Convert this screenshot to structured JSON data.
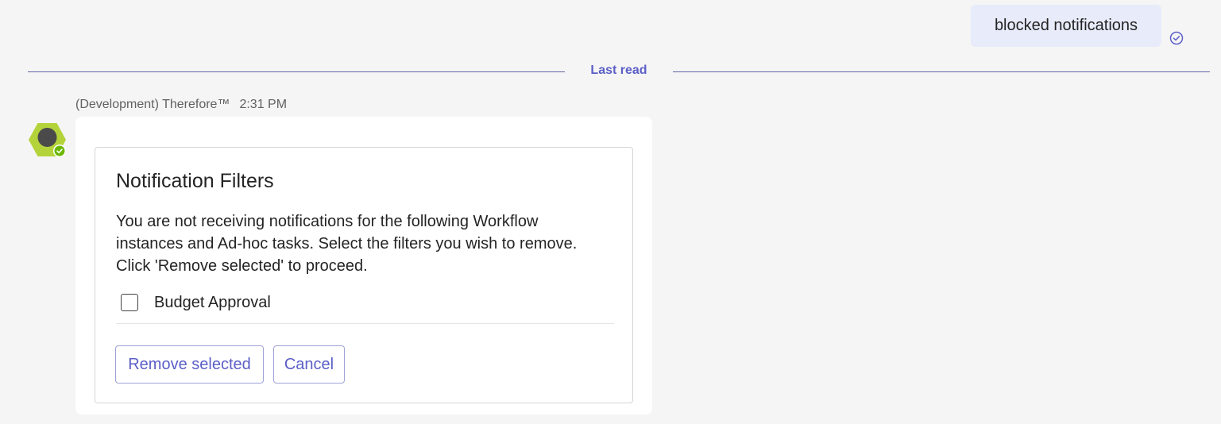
{
  "sent_message": {
    "text": "blocked notifications",
    "read_icon": "check-circle-icon"
  },
  "divider": {
    "label": "Last read"
  },
  "message": {
    "sender": "(Development) Therefore™",
    "time": "2:31 PM",
    "avatar_icon": "bot-avatar-icon"
  },
  "card": {
    "title": "Notification Filters",
    "description_lines": [
      "You are not receiving notifications for the following Workflow",
      "instances and Ad-hoc tasks. Select the filters you wish to remove.",
      "Click 'Remove selected' to proceed."
    ],
    "filters": [
      {
        "label": "Budget Approval",
        "checked": false
      }
    ],
    "buttons": {
      "remove": "Remove selected",
      "cancel": "Cancel"
    }
  },
  "colors": {
    "accent": "#5b5fc7",
    "bubble": "#e8ebfa",
    "avatar_hex": "#b4d33a",
    "status_green": "#6bb700"
  }
}
